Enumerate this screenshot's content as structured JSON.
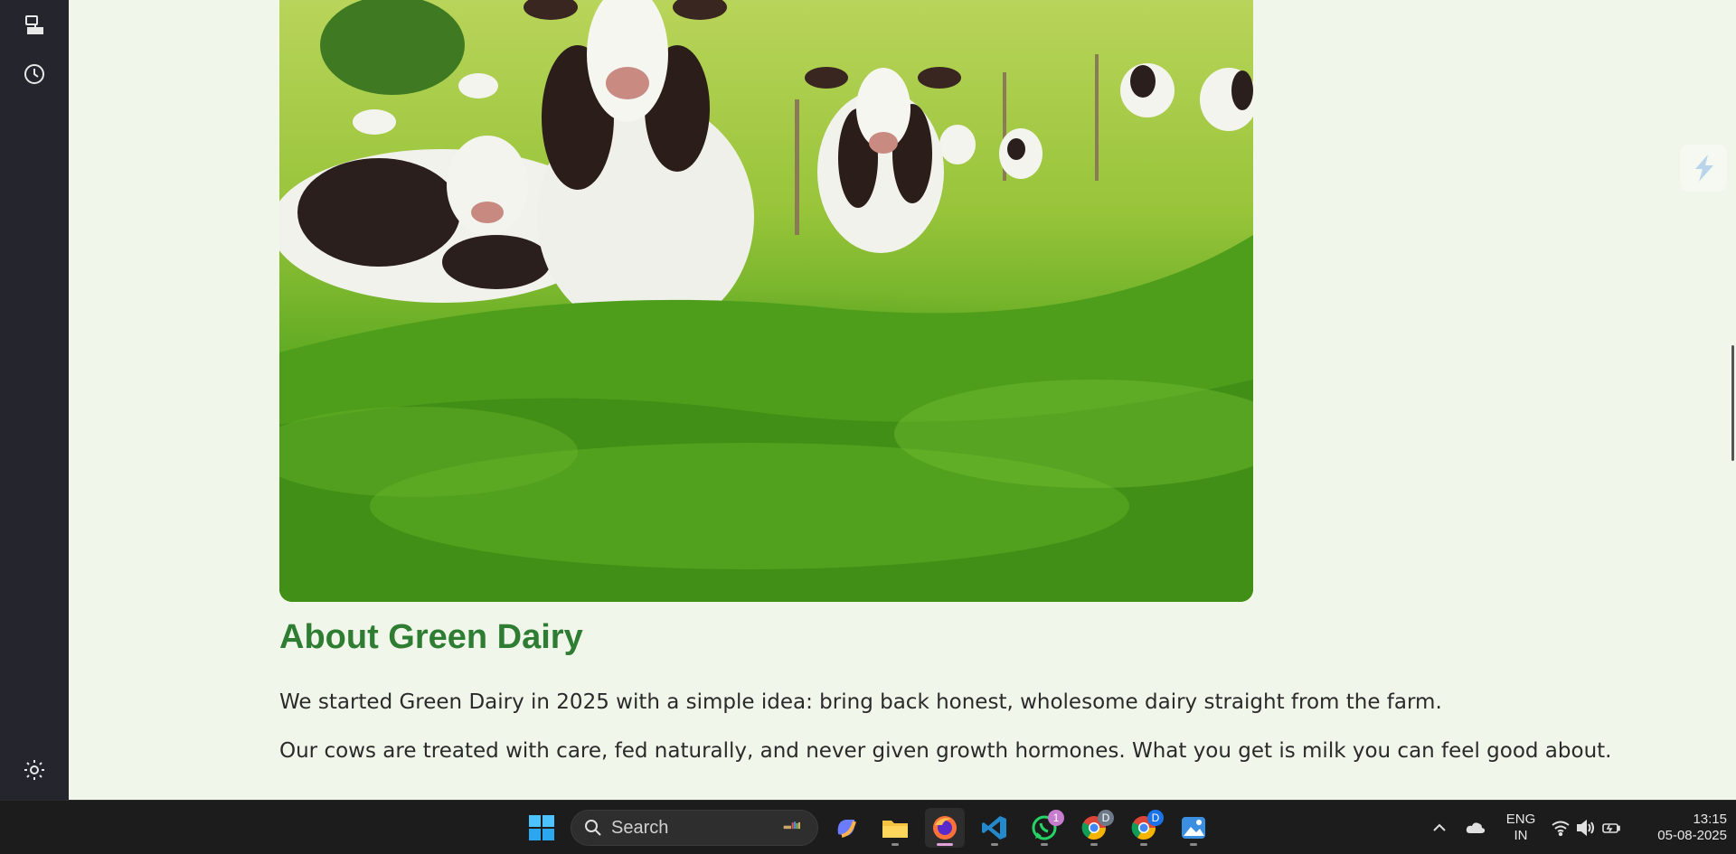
{
  "sidebar": {
    "items": [
      {
        "icon": "device-sync-icon"
      },
      {
        "icon": "history-icon"
      },
      {
        "icon": "gear-icon"
      }
    ]
  },
  "page": {
    "hero_image": "cows-grazing-green-pasture",
    "about_title": "About Green Dairy",
    "paragraphs": [
      "We started Green Dairy in 2025 with a simple idea: bring back honest, wholesome dairy straight from the farm.",
      "Our cows are treated with care, fed naturally, and never given growth hormones. What you get is milk you can feel good about."
    ],
    "colors": {
      "accent": "#2e7d32",
      "background": "#f0f6ea"
    }
  },
  "taskbar": {
    "search_label": "Search",
    "apps": [
      {
        "name": "windows-start",
        "icon": "windows-logo-icon"
      },
      {
        "name": "copilot",
        "icon": "copilot-icon"
      },
      {
        "name": "file-explorer",
        "icon": "folder-icon"
      },
      {
        "name": "firefox",
        "icon": "firefox-icon",
        "active": true
      },
      {
        "name": "vscode",
        "icon": "vscode-icon"
      },
      {
        "name": "whatsapp",
        "icon": "whatsapp-icon",
        "badge": "1"
      },
      {
        "name": "chrome-profile-1",
        "icon": "chrome-icon",
        "badge": "D"
      },
      {
        "name": "chrome-profile-2",
        "icon": "chrome-icon",
        "badge": "D"
      },
      {
        "name": "photos",
        "icon": "photos-icon"
      }
    ],
    "tray": {
      "lang_line1": "ENG",
      "lang_line2": "IN",
      "time": "13:15",
      "date": "05-08-2025"
    }
  }
}
